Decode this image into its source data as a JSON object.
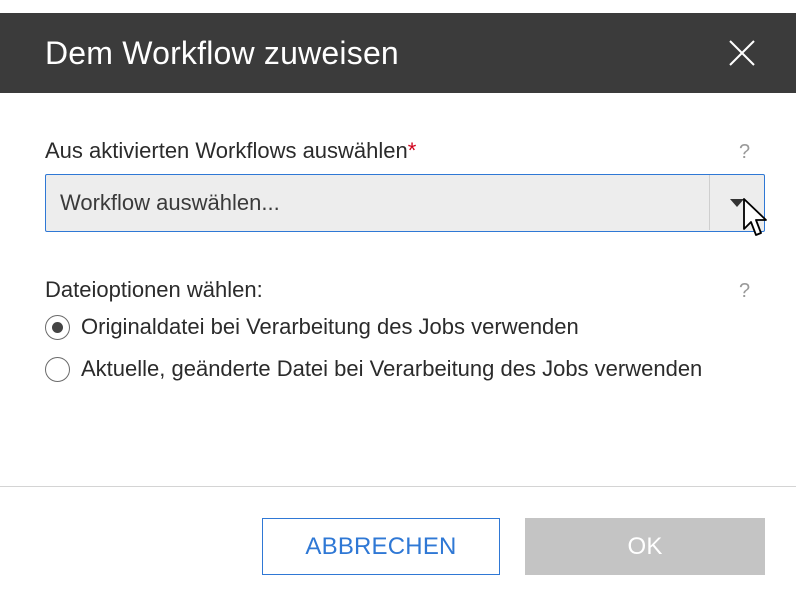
{
  "dialog": {
    "title": "Dem Workflow zuweisen",
    "close_icon": "close-icon"
  },
  "workflow_select": {
    "label": "Aus aktivierten Workflows auswählen",
    "required_marker": "*",
    "help": "?",
    "placeholder": "Workflow auswählen...",
    "arrow_icon": "caret-down-icon"
  },
  "file_options": {
    "label": "Dateioptionen wählen:",
    "help": "?",
    "options": [
      {
        "label": "Originaldatei bei Verarbeitung des Jobs verwenden",
        "selected": true
      },
      {
        "label": "Aktuelle, geänderte Datei bei Verarbeitung des Jobs verwenden",
        "selected": false
      }
    ]
  },
  "buttons": {
    "cancel": "ABBRECHEN",
    "ok": "OK",
    "ok_disabled": true
  },
  "colors": {
    "titlebar": "#3b3b3b",
    "accent": "#2f78d5",
    "required": "#d0021b",
    "disabled_button": "#c4c4c4"
  }
}
